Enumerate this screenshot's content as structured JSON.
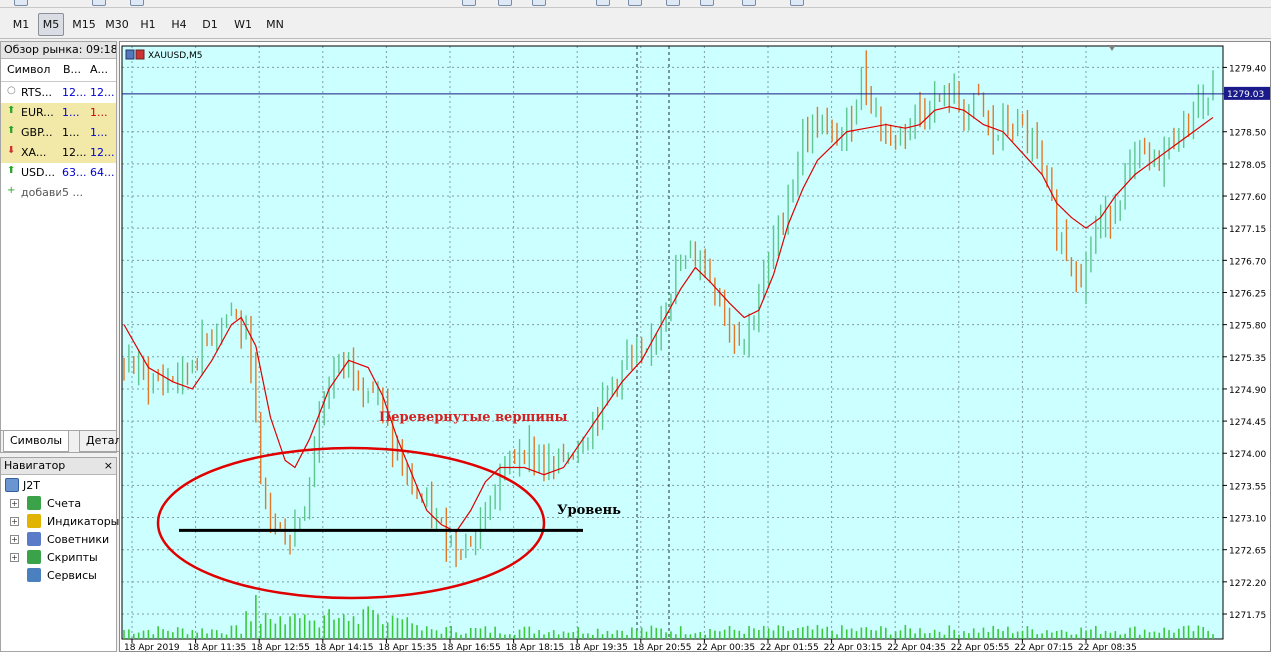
{
  "timeframes": {
    "items": [
      "M1",
      "M5",
      "M15",
      "M30",
      "H1",
      "H4",
      "D1",
      "W1",
      "MN"
    ],
    "active": "M5"
  },
  "market_watch": {
    "title": "Обзор рынка: 09:18",
    "columns": [
      "Символ",
      "В...",
      "А..."
    ],
    "rows": [
      {
        "symbol": "RTS...",
        "bid": "12...",
        "ask": "12...",
        "icon": "grey-circle",
        "bid_color": "#0000d0",
        "ask_color": "#0000d0",
        "highlight": false
      },
      {
        "symbol": "EUR...",
        "bid": "1...",
        "ask": "1...",
        "icon": "green-up-arrow",
        "bid_color": "#0000d0",
        "ask_color": "#d00000",
        "highlight": true
      },
      {
        "symbol": "GBP...",
        "bid": "1...",
        "ask": "1...",
        "icon": "green-up-arrow",
        "bid_color": "#000000",
        "ask_color": "#0000d0",
        "highlight": true
      },
      {
        "symbol": "XA...",
        "bid": "12...",
        "ask": "12...",
        "icon": "red-down-arrow",
        "bid_color": "#000000",
        "ask_color": "#0000d0",
        "highlight": true
      },
      {
        "symbol": "USD...",
        "bid": "63...",
        "ask": "64...",
        "icon": "green-up-arrow",
        "bid_color": "#0000d0",
        "ask_color": "#0000d0",
        "highlight": false
      },
      {
        "symbol": "добавить...",
        "bid": "5 ...",
        "ask": "",
        "icon": "green-plus",
        "bid_color": "#666666",
        "ask_color": "#666666",
        "highlight": false
      }
    ],
    "tabs": [
      "Символы",
      "Детали"
    ]
  },
  "navigator": {
    "title": "Навигатор",
    "close": "×",
    "root": "J2T",
    "items": [
      {
        "label": "Счета",
        "icon": "accounts-icon",
        "color": "#3aa34a"
      },
      {
        "label": "Индикаторы",
        "icon": "indicators-icon",
        "color": "#e0b400"
      },
      {
        "label": "Советники",
        "icon": "experts-icon",
        "color": "#5a7bc8"
      },
      {
        "label": "Скрипты",
        "icon": "scripts-icon",
        "color": "#3aa34a"
      },
      {
        "label": "Сервисы",
        "icon": "services-icon",
        "color": "#4a7fc0"
      }
    ]
  },
  "chart": {
    "symbol_label": "XAUUSD,M5",
    "current_price": "1279.03",
    "annotation_inverted_tops": "Перевернутые вершины",
    "annotation_level": "Уровень",
    "colors": {
      "background": "#ccffff",
      "grid": "#7f9f9f",
      "bull": "#5fc58f",
      "bear": "#e07a2a",
      "ma": "#e00000",
      "volume": "#3cc83c",
      "price_line": "#1a1a8a",
      "ellipse": "#e00000",
      "level_line": "#000000",
      "annotation_red": "#d42020"
    }
  },
  "chart_data": {
    "type": "candlestick",
    "symbol": "XAUUSD",
    "timeframe": "M5",
    "y_ticks": [
      "1279.40",
      "1279.03",
      "1278.50",
      "1278.05",
      "1277.60",
      "1277.15",
      "1276.70",
      "1276.25",
      "1275.80",
      "1275.35",
      "1274.90",
      "1274.45",
      "1274.00",
      "1273.55",
      "1273.10",
      "1272.65",
      "1272.20",
      "1271.75"
    ],
    "x_ticks": [
      "18 Apr 2019",
      "18 Apr 11:35",
      "18 Apr 12:55",
      "18 Apr 14:15",
      "18 Apr 15:35",
      "18 Apr 16:55",
      "18 Apr 18:15",
      "18 Apr 19:35",
      "18 Apr 20:55",
      "22 Apr 00:35",
      "22 Apr 01:55",
      "22 Apr 03:15",
      "22 Apr 04:35",
      "22 Apr 05:55",
      "22 Apr 07:15",
      "22 Apr 08:35"
    ],
    "ylim": [
      1271.4,
      1279.7
    ],
    "last_price": 1279.03,
    "level": 1272.92,
    "close_path": [
      [
        0,
        1275.3
      ],
      [
        6,
        1275.0
      ],
      [
        12,
        1275.1
      ],
      [
        18,
        1275.7
      ],
      [
        22,
        1276.0
      ],
      [
        26,
        1275.4
      ],
      [
        28,
        1273.5
      ],
      [
        31,
        1273.0
      ],
      [
        34,
        1272.8
      ],
      [
        37,
        1273.3
      ],
      [
        40,
        1274.5
      ],
      [
        43,
        1275.2
      ],
      [
        46,
        1275.3
      ],
      [
        49,
        1275.0
      ],
      [
        52,
        1274.8
      ],
      [
        55,
        1274.1
      ],
      [
        58,
        1273.6
      ],
      [
        61,
        1273.3
      ],
      [
        64,
        1273.0
      ],
      [
        67,
        1272.8
      ],
      [
        70,
        1272.7
      ],
      [
        73,
        1273.0
      ],
      [
        76,
        1273.5
      ],
      [
        79,
        1273.9
      ],
      [
        82,
        1274.1
      ],
      [
        85,
        1273.9
      ],
      [
        88,
        1273.8
      ],
      [
        91,
        1274.0
      ],
      [
        94,
        1274.2
      ],
      [
        97,
        1274.6
      ],
      [
        100,
        1275.0
      ],
      [
        103,
        1275.3
      ],
      [
        107,
        1275.3
      ],
      [
        111,
        1276.2
      ],
      [
        114,
        1276.6
      ],
      [
        118,
        1276.8
      ],
      [
        121,
        1276.3
      ],
      [
        124,
        1275.8
      ],
      [
        127,
        1275.6
      ],
      [
        130,
        1276.2
      ],
      [
        133,
        1276.9
      ],
      [
        136,
        1277.6
      ],
      [
        139,
        1278.4
      ],
      [
        142,
        1278.6
      ],
      [
        145,
        1278.4
      ],
      [
        148,
        1278.5
      ],
      [
        151,
        1279.3
      ],
      [
        154,
        1278.8
      ],
      [
        157,
        1278.3
      ],
      [
        160,
        1278.6
      ],
      [
        163,
        1278.8
      ],
      [
        166,
        1278.9
      ],
      [
        169,
        1279.0
      ],
      [
        172,
        1278.8
      ],
      [
        175,
        1278.9
      ],
      [
        178,
        1278.4
      ],
      [
        181,
        1278.6
      ],
      [
        184,
        1278.5
      ],
      [
        187,
        1278.2
      ],
      [
        190,
        1277.4
      ],
      [
        193,
        1276.8
      ],
      [
        196,
        1276.5
      ],
      [
        199,
        1277.1
      ],
      [
        202,
        1277.4
      ],
      [
        205,
        1277.8
      ],
      [
        208,
        1278.2
      ],
      [
        211,
        1278.0
      ],
      [
        214,
        1278.3
      ],
      [
        217,
        1278.6
      ],
      [
        220,
        1278.9
      ],
      [
        223,
        1279.03
      ]
    ],
    "ma_path": [
      [
        0,
        1275.8
      ],
      [
        5,
        1275.2
      ],
      [
        10,
        1275.0
      ],
      [
        14,
        1274.9
      ],
      [
        18,
        1275.3
      ],
      [
        22,
        1275.8
      ],
      [
        24,
        1275.9
      ],
      [
        27,
        1275.5
      ],
      [
        30,
        1274.5
      ],
      [
        33,
        1273.9
      ],
      [
        35,
        1273.8
      ],
      [
        38,
        1274.2
      ],
      [
        42,
        1274.9
      ],
      [
        46,
        1275.3
      ],
      [
        50,
        1275.2
      ],
      [
        53,
        1274.8
      ],
      [
        56,
        1274.2
      ],
      [
        59,
        1273.7
      ],
      [
        62,
        1273.2
      ],
      [
        65,
        1273.0
      ],
      [
        68,
        1272.9
      ],
      [
        71,
        1273.2
      ],
      [
        74,
        1273.6
      ],
      [
        77,
        1273.8
      ],
      [
        82,
        1273.8
      ],
      [
        86,
        1273.7
      ],
      [
        90,
        1273.8
      ],
      [
        94,
        1274.2
      ],
      [
        98,
        1274.6
      ],
      [
        102,
        1275.0
      ],
      [
        106,
        1275.3
      ],
      [
        110,
        1275.8
      ],
      [
        114,
        1276.3
      ],
      [
        117,
        1276.6
      ],
      [
        120,
        1276.4
      ],
      [
        124,
        1276.1
      ],
      [
        127,
        1275.9
      ],
      [
        130,
        1276.0
      ],
      [
        133,
        1276.5
      ],
      [
        136,
        1277.2
      ],
      [
        139,
        1277.7
      ],
      [
        142,
        1278.1
      ],
      [
        145,
        1278.3
      ],
      [
        148,
        1278.5
      ],
      [
        152,
        1278.55
      ],
      [
        156,
        1278.6
      ],
      [
        160,
        1278.55
      ],
      [
        163,
        1278.6
      ],
      [
        166,
        1278.8
      ],
      [
        169,
        1278.85
      ],
      [
        172,
        1278.8
      ],
      [
        176,
        1278.6
      ],
      [
        180,
        1278.5
      ],
      [
        184,
        1278.2
      ],
      [
        188,
        1277.9
      ],
      [
        191,
        1277.5
      ],
      [
        194,
        1277.3
      ],
      [
        197,
        1277.15
      ],
      [
        200,
        1277.3
      ],
      [
        203,
        1277.6
      ],
      [
        207,
        1277.9
      ],
      [
        211,
        1278.1
      ],
      [
        215,
        1278.3
      ],
      [
        219,
        1278.5
      ],
      [
        223,
        1278.7
      ]
    ]
  }
}
